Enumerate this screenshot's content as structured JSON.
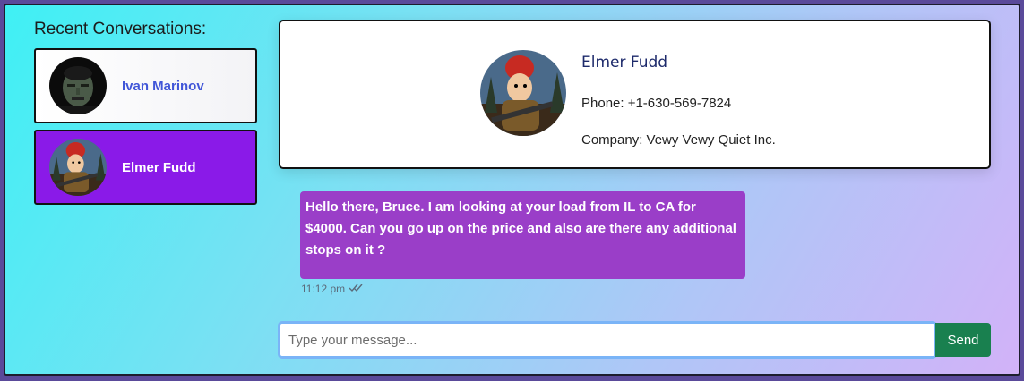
{
  "sidebar": {
    "title": "Recent Conversations:",
    "conversations": [
      {
        "name": "Ivan Marinov",
        "active": false
      },
      {
        "name": "Elmer Fudd",
        "active": true
      }
    ]
  },
  "contact": {
    "name": "Elmer Fudd",
    "phone": "Phone: +1-630-569-7824",
    "company": "Company: Vewy Vewy Quiet Inc."
  },
  "messages": [
    {
      "text": "Hello there, Bruce. I am looking at your load from IL to CA for $4000. Can you go up on the price and also are there any additional stops on it ?",
      "time": "11:12 pm",
      "status_icon": "double-check-icon"
    }
  ],
  "composer": {
    "placeholder": "Type your message...",
    "value": "",
    "send_label": "Send"
  },
  "colors": {
    "active_conversation": "#8a1ae8",
    "message_bubble": "#9a3ec8",
    "send_button": "#19804f",
    "link_name": "#4156d8"
  }
}
